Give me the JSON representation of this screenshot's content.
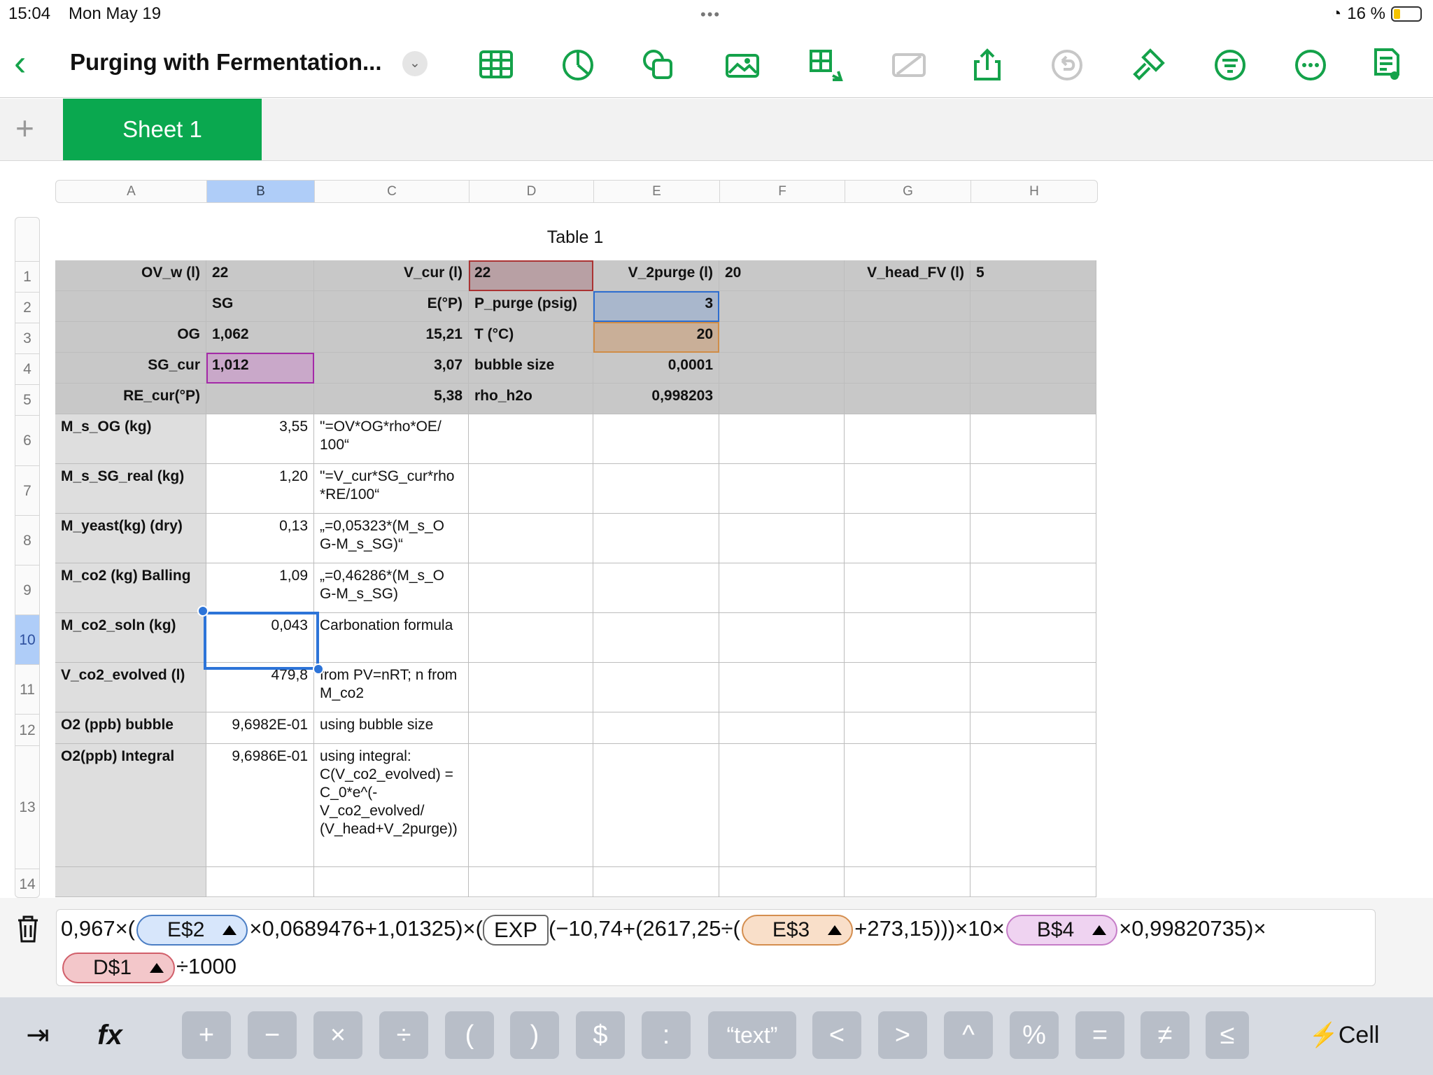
{
  "status_bar": {
    "time": "15:04",
    "date": "Mon May 19",
    "battery": "16 %",
    "multitask": "•••"
  },
  "toolbar": {
    "title": "Purging with Fermentation...",
    "icons": [
      "table-icon",
      "chart-icon",
      "shape-icon",
      "media-icon",
      "table-size-icon",
      "crop-icon",
      "share-icon",
      "undo-icon",
      "format-brush-icon",
      "filter-icon",
      "more-icon",
      "document-view-icon"
    ],
    "accent": "#14a24a"
  },
  "tabs": {
    "add": "+",
    "active_sheet": "Sheet 1"
  },
  "columns": [
    "A",
    "B",
    "C",
    "D",
    "E",
    "F",
    "G",
    "H"
  ],
  "rows": [
    "1",
    "2",
    "3",
    "4",
    "5",
    "6",
    "7",
    "8",
    "9",
    "10",
    "11",
    "12",
    "13",
    "14"
  ],
  "table": {
    "title": "Table 1",
    "cells": [
      [
        "OV_w (l)",
        "22",
        "V_cur (l)",
        "22",
        "V_2purge (l)",
        "20",
        "V_head_FV (l)",
        "5"
      ],
      [
        "",
        "SG",
        "E(°P)",
        "P_purge (psig)",
        "3",
        "",
        "",
        ""
      ],
      [
        "OG",
        "1,062",
        "15,21",
        "T (°C)",
        "20",
        "",
        "",
        ""
      ],
      [
        "SG_cur",
        "1,012",
        "3,07",
        "bubble size",
        "0,0001",
        "",
        "",
        ""
      ],
      [
        "RE_cur(°P)",
        "",
        "5,38",
        "rho_h2o",
        "0,998203",
        "",
        "",
        ""
      ],
      [
        "M_s_OG (kg)",
        "3,55",
        "\"=OV*OG*rho*OE/ 100“",
        "",
        "",
        "",
        "",
        ""
      ],
      [
        "M_s_SG_real (kg)",
        "1,20",
        "\"=V_cur*SG_cur*rho *RE/100“",
        "",
        "",
        "",
        "",
        ""
      ],
      [
        "M_yeast(kg) (dry)",
        "0,13",
        "„=0,05323*(M_s_O G-M_s_SG)“",
        "",
        "",
        "",
        "",
        ""
      ],
      [
        "M_co2 (kg) Balling",
        "1,09",
        "„=0,46286*(M_s_O G-M_s_SG)",
        "",
        "",
        "",
        "",
        ""
      ],
      [
        "M_co2_soln (kg)",
        "0,043",
        "Carbonation formula",
        "",
        "",
        "",
        "",
        ""
      ],
      [
        "V_co2_evolved (l)",
        "479,8",
        "from PV=nRT; n from M_co2",
        "",
        "",
        "",
        "",
        ""
      ],
      [
        "O2 (ppb) bubble",
        "9,6982E-01",
        "using bubble size",
        "",
        "",
        "",
        "",
        ""
      ],
      [
        "O2(ppb) Integral",
        "9,6986E-01",
        "using integral: C(V_co2_evolved) = C_0*e^(- V_co2_evolved/ (V_head+V_2purge))",
        "",
        "",
        "",
        "",
        ""
      ],
      [
        "",
        "",
        "",
        "",
        "",
        "",
        "",
        ""
      ]
    ]
  },
  "formula": {
    "p1": "0,967×(",
    "ref1": "E$2",
    "p2": "×0,0689476+1,01325)×(",
    "func": "EXP",
    "p3": "(−10,74+(2617,25÷(",
    "ref2": "E$3",
    "p4": "+273,15)))",
    "p5": "×10×",
    "ref3": "B$4",
    "p6": "×0,99820735)×",
    "ref4": "D$1",
    "p7": "÷1000"
  },
  "keyboard": {
    "tab": "⇥",
    "fx": "fx",
    "keys": [
      "+",
      "−",
      "×",
      "÷",
      "(",
      ")",
      "$",
      ":",
      "“text”",
      "<",
      ">",
      "^",
      "%",
      "=",
      "≠",
      "≤"
    ],
    "cell": "Cell"
  }
}
